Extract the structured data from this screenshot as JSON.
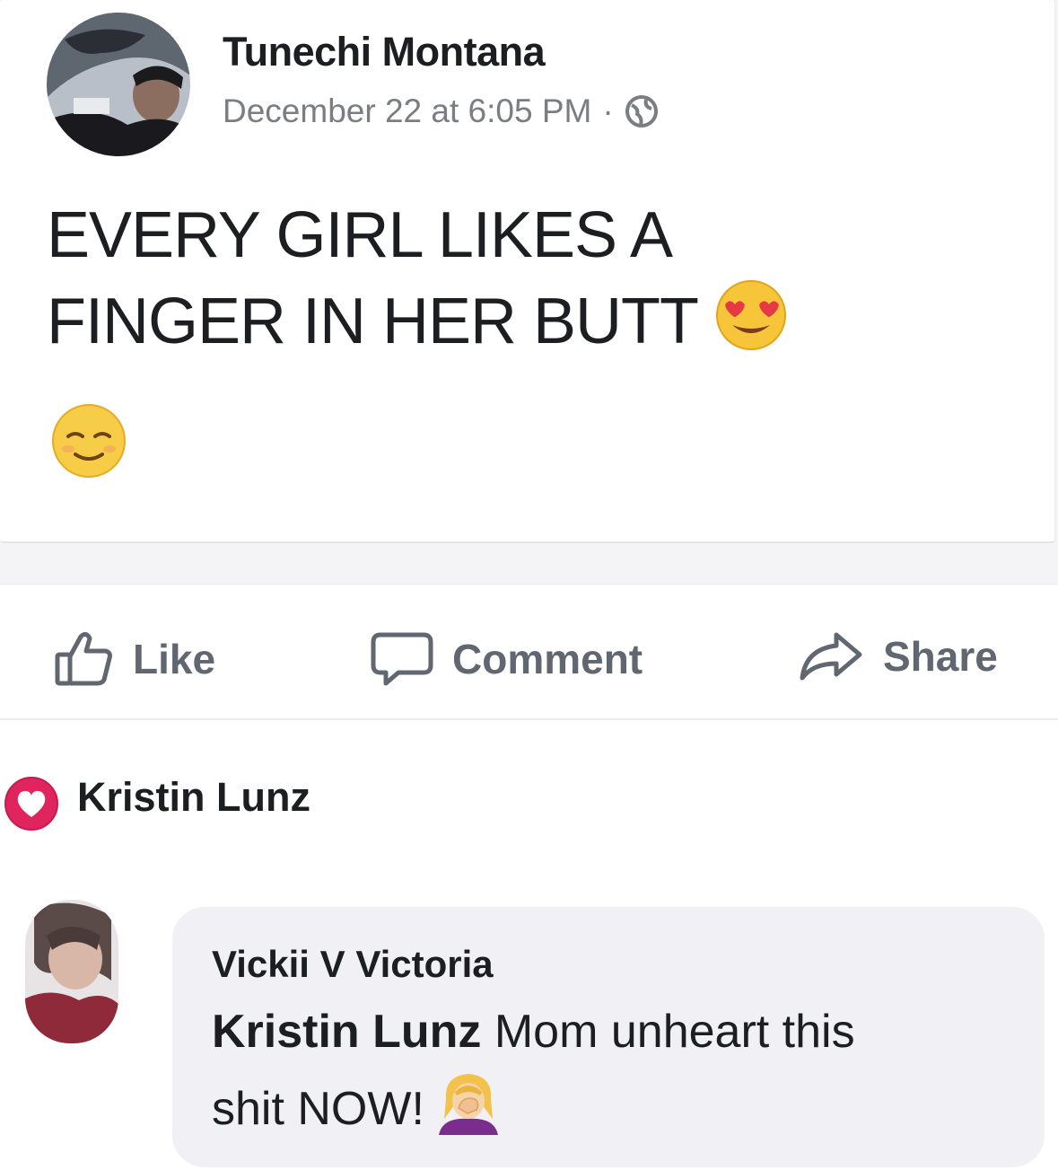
{
  "post": {
    "author": "Tunechi Montana",
    "timestamp": "December 22 at 6:05 PM",
    "separator": "·",
    "privacy_icon": "globe-icon",
    "text_line1": "EVERY GIRL LIKES A",
    "text_line2": "FINGER IN HER BUTT",
    "emojis": [
      "heart-eyes-emoji",
      "relieved-emoji"
    ]
  },
  "actions": {
    "like_label": "Like",
    "comment_label": "Comment",
    "share_label": "Share"
  },
  "reaction": {
    "icon": "heart-reaction-icon",
    "name": "Kristin Lunz"
  },
  "comment": {
    "author": "Vickii V Victoria",
    "mention": "Kristin Lunz",
    "text_part1": " Mom unheart this",
    "text_part2": "shit NOW!",
    "emoji": "woman-facepalming-emoji"
  },
  "colors": {
    "text": "#1c1e21",
    "meta": "#7a7d82",
    "action": "#606770",
    "bubble": "#f0f0f5",
    "heart": "#e0245e"
  }
}
